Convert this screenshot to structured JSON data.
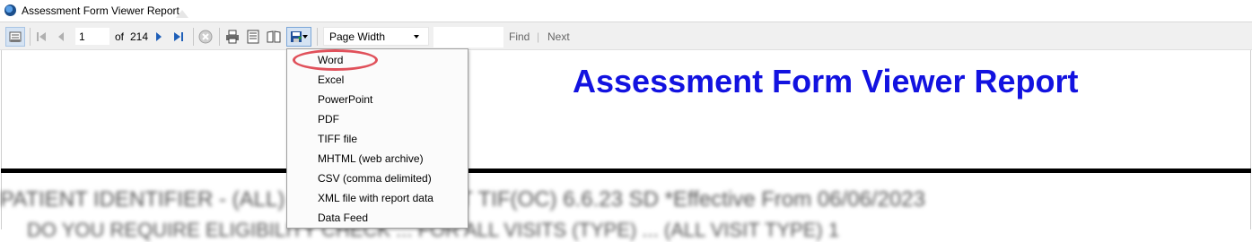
{
  "window": {
    "title": "Assessment Form Viewer Report"
  },
  "toolbar": {
    "current_page": "1",
    "of_label": "of",
    "total_pages": "214",
    "zoom": "Page Width",
    "find_value": "",
    "find_label": "Find",
    "find_separator": "|",
    "next_label": "Next"
  },
  "report": {
    "title": "Assessment Form Viewer Report",
    "line1": "PATIENT IDENTIFIER - (ALL) ... OASIS EXCEPT TIF(OC) 6.6.23 SD     *Effective From 06/06/2023",
    "line2": "DO YOU REQUIRE ELIGIBILITY CHECK ... FOR ALL VISITS (TYPE) ... (ALL VISIT TYPE) 1"
  },
  "export_menu": {
    "items": [
      {
        "label": "Word"
      },
      {
        "label": "Excel"
      },
      {
        "label": "PowerPoint"
      },
      {
        "label": "PDF"
      },
      {
        "label": "TIFF file"
      },
      {
        "label": "MHTML (web archive)"
      },
      {
        "label": "CSV (comma delimited)"
      },
      {
        "label": "XML file with report data"
      },
      {
        "label": "Data Feed"
      }
    ]
  },
  "colors": {
    "report_title": "#1212e0",
    "highlight_ring": "#e0505a",
    "nav_arrow": "#1f5fb8"
  }
}
